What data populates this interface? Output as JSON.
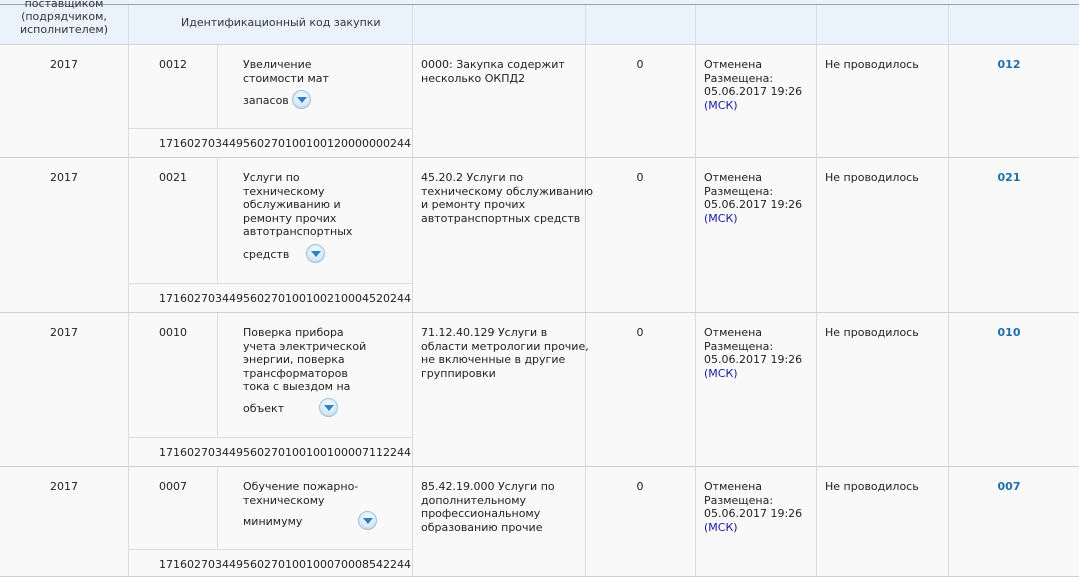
{
  "header": {
    "supplier_col_lines": [
      "поставщиком",
      "(подрядчиком,",
      "исполнителем)"
    ],
    "code_col": "Идентификационный код закупки"
  },
  "rows": [
    {
      "year": "2017",
      "num": "0012",
      "name_lines": [
        "Увеличение",
        "стоимости мат"
      ],
      "name_last": "запасов",
      "okpd": [
        "0000: Закупка содержит",
        "несколько ОКПД2"
      ],
      "amount": "0",
      "status": "Отменена",
      "placed_label": "Размещена:",
      "date": "05.06.2017 19:26",
      "tz": "(МСК)",
      "held": "Не проводилось",
      "link": "012",
      "code": "171602703449560270100100120000000244"
    },
    {
      "year": "2017",
      "num": "0021",
      "name_lines": [
        "Услуги по",
        "техническому",
        "обслуживанию и",
        "ремонту прочих",
        "автотранспортных"
      ],
      "name_last": "средств",
      "okpd": [
        "45.20.2 Услуги по",
        "техническому обслуживанию",
        "и ремонту прочих",
        "автотранспортных средств"
      ],
      "amount": "0",
      "status": "Отменена",
      "placed_label": "Размещена:",
      "date": "05.06.2017 19:26",
      "tz": "(МСК)",
      "held": "Не проводилось",
      "link": "021",
      "code": "171602703449560270100100210004520244"
    },
    {
      "year": "2017",
      "num": "0010",
      "name_lines": [
        "Поверка прибора",
        "учета электрической",
        "энергии, поверка",
        "трансформаторов",
        "тока с выездом на"
      ],
      "name_last": "объект",
      "okpd": [
        "71.12.40.129 Услуги в",
        "области метрологии прочие,",
        "не включенные в другие",
        "группировки"
      ],
      "amount": "0",
      "status": "Отменена",
      "placed_label": "Размещена:",
      "date": "05.06.2017 19:26",
      "tz": "(МСК)",
      "held": "Не проводилось",
      "link": "010",
      "code": "171602703449560270100100100007112244"
    },
    {
      "year": "2017",
      "num": "0007",
      "name_lines": [
        "Обучение пожарно-",
        "техническому"
      ],
      "name_last": "минимуму",
      "okpd": [
        "85.42.19.000 Услуги по",
        "дополнительному",
        "профессиональному",
        "образованию прочие"
      ],
      "amount": "0",
      "status": "Отменена",
      "placed_label": "Размещена:",
      "date": "05.06.2017 19:26",
      "tz": "(МСК)",
      "held": "Не проводилось",
      "link": "007",
      "code": "171602703449560270100100070008542244"
    }
  ]
}
